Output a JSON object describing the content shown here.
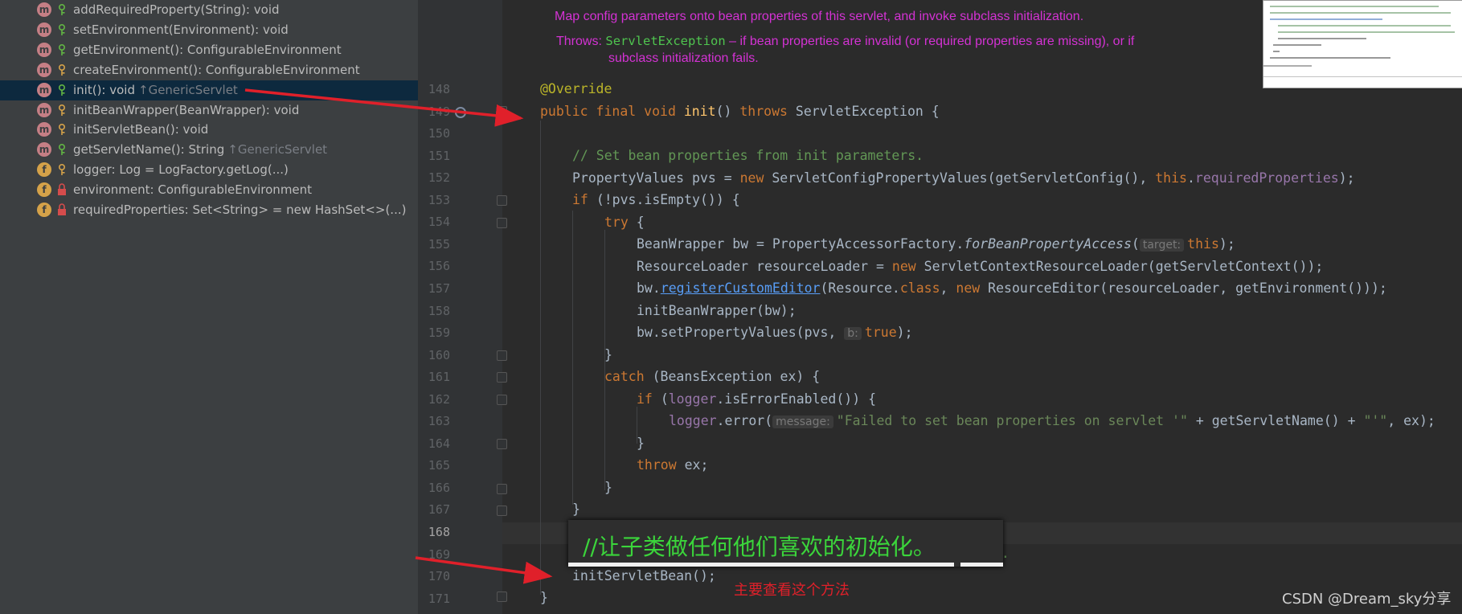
{
  "structure": {
    "members": [
      {
        "kind": "m",
        "access": "public",
        "name": "addRequiredProperty(String): void",
        "inherited": ""
      },
      {
        "kind": "m",
        "access": "public",
        "name": "setEnvironment(Environment): void",
        "inherited": ""
      },
      {
        "kind": "m",
        "access": "public",
        "name": "getEnvironment(): ConfigurableEnvironment",
        "inherited": ""
      },
      {
        "kind": "m",
        "access": "protected",
        "name": "createEnvironment(): ConfigurableEnvironment",
        "inherited": ""
      },
      {
        "kind": "m",
        "access": "public",
        "name": "init(): void",
        "inherited": "↑GenericServlet",
        "selected": true
      },
      {
        "kind": "m",
        "access": "protected",
        "name": "initBeanWrapper(BeanWrapper): void",
        "inherited": ""
      },
      {
        "kind": "m",
        "access": "protected",
        "name": "initServletBean(): void",
        "inherited": ""
      },
      {
        "kind": "m",
        "access": "public",
        "name": "getServletName(): String",
        "inherited": "↑GenericServlet"
      },
      {
        "kind": "f",
        "access": "protected",
        "name": "logger: Log = LogFactory.getLog(...)",
        "inherited": ""
      },
      {
        "kind": "f",
        "access": "private",
        "name": "environment: ConfigurableEnvironment",
        "inherited": ""
      },
      {
        "kind": "f",
        "access": "private",
        "name": "requiredProperties: Set<String> = new HashSet<>(...)",
        "inherited": ""
      }
    ]
  },
  "doc": {
    "summary": "Map config parameters onto bean properties of this servlet, and invoke subclass initialization.",
    "throws_label": "Throws:",
    "throws_type": "ServletException",
    "throws_text1": " – if bean properties are invalid (or required properties are missing), or if",
    "throws_text2": "subclass initialization fails."
  },
  "editor": {
    "line_numbers": [
      "148",
      "149",
      "150",
      "151",
      "152",
      "153",
      "154",
      "155",
      "156",
      "157",
      "158",
      "159",
      "160",
      "161",
      "162",
      "163",
      "164",
      "165",
      "166",
      "167",
      "168",
      "169",
      "170",
      "171"
    ],
    "current_line": "168",
    "code": {
      "l148": "@Override",
      "l149_kw": "public final void ",
      "l149_name": "init",
      "l149_mid": "() ",
      "l149_throws": "throws ",
      "l149_end": "ServletException {",
      "l151": "// Set bean properties from init parameters.",
      "l152_a": "PropertyValues pvs = ",
      "l152_new": "new ",
      "l152_b": "ServletConfigPropertyValues(getServletConfig(), ",
      "l152_this": "this",
      "l152_dot": ".",
      "l152_field": "requiredProperties",
      "l152_end": ");",
      "l153_if": "if ",
      "l153_end": "(!pvs.isEmpty()) {",
      "l154": "try ",
      "l154_b": "{",
      "l155_a": "BeanWrapper bw = PropertyAccessorFactory.",
      "l155_it": "forBeanPropertyAccess",
      "l155_b": "(",
      "l155_hint": "target:",
      "l155_this": "this",
      "l155_end": ");",
      "l156_a": "ResourceLoader resourceLoader = ",
      "l156_new": "new ",
      "l156_b": "ServletContextResourceLoader(getServletContext());",
      "l157_a": "bw.",
      "l157_ul": "registerCustomEditor",
      "l157_b": "(Resource.",
      "l157_class": "class",
      "l157_c": ", ",
      "l157_new": "new ",
      "l157_d": "ResourceEditor(resourceLoader, getEnvironment()));",
      "l158": "initBeanWrapper(bw);",
      "l159_a": "bw.setPropertyValues(pvs, ",
      "l159_hint": "b:",
      "l159_true": "true",
      "l159_end": ");",
      "l160": "}",
      "l161_catch": "catch ",
      "l161_end": "(BeansException ex) {",
      "l162_if": "if ",
      "l162_b": "(",
      "l162_logger": "logger",
      "l162_end": ".isErrorEnabled()) {",
      "l163_logger": "logger",
      "l163_a": ".error(",
      "l163_hint": "message:",
      "l163_str": "\"Failed to set bean properties on servlet '\"",
      "l163_b": " + getServletName() + ",
      "l163_str2": "\"'\"",
      "l163_end": ", ex);",
      "l164": "}",
      "l165_throw": "throw ",
      "l165_end": "ex;",
      "l166": "}",
      "l167": "}",
      "l169_tail": "e.",
      "l170": "initServletBean();",
      "l171": "}"
    }
  },
  "overlay": {
    "text": "//让子类做任何他们喜欢的初始化。"
  },
  "annotation": {
    "note": "主要查看这个方法"
  },
  "watermark": "CSDN @Dream_sky分享",
  "colors": {
    "background": "#2b2b2b",
    "panel": "#3c3f41",
    "selection": "#0d293e",
    "keyword": "#cc7832",
    "comment": "#629755",
    "string": "#6a8759",
    "arrow": "#e0202a"
  }
}
